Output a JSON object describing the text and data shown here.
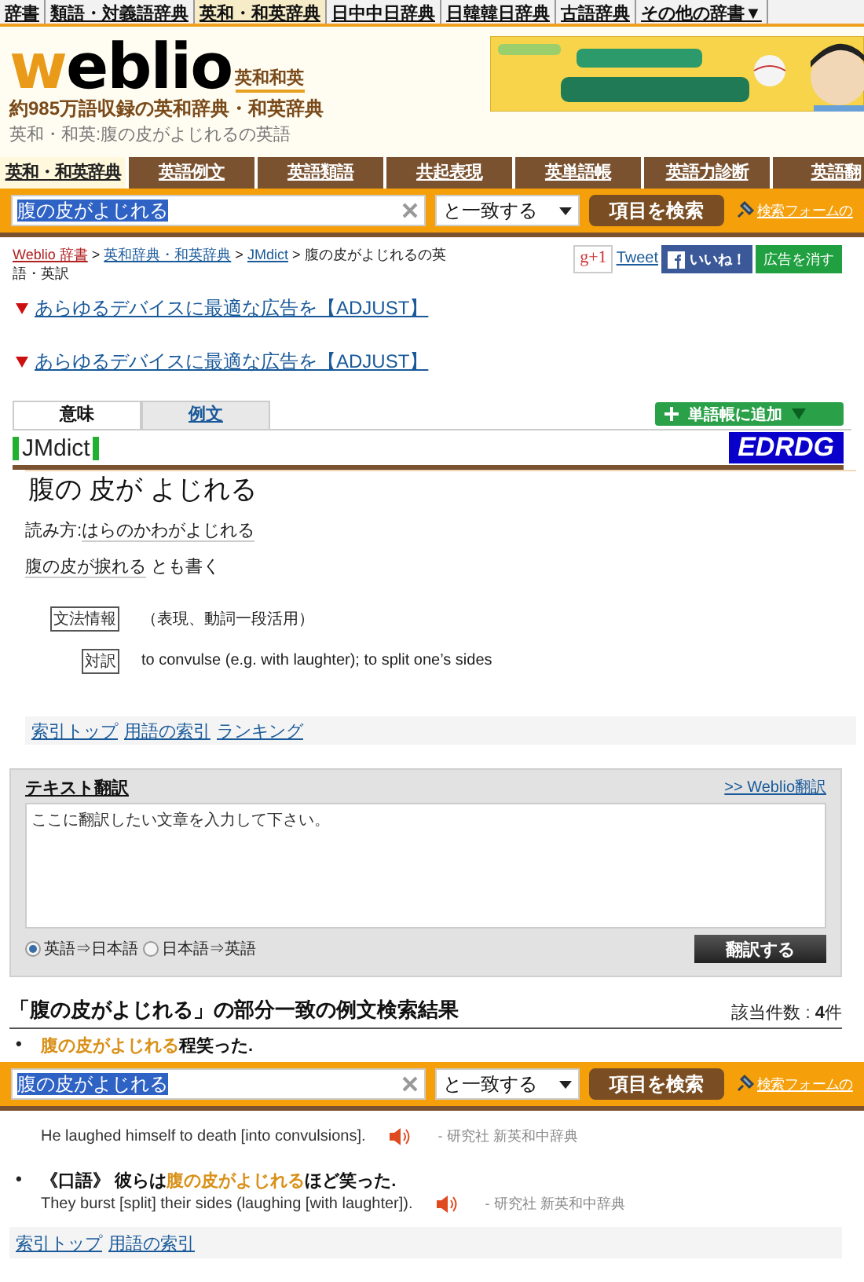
{
  "dict_nav": [
    {
      "label": "辞書",
      "selected": false
    },
    {
      "label": "類語・対義語辞典",
      "selected": false
    },
    {
      "label": "英和・和英辞典",
      "selected": true
    },
    {
      "label": "日中中日辞典",
      "selected": false
    },
    {
      "label": "日韓韓日辞典",
      "selected": false
    },
    {
      "label": "古語辞典",
      "selected": false
    },
    {
      "label": "その他の辞書▼",
      "selected": false
    }
  ],
  "header": {
    "logo_first": "w",
    "logo_rest": "eblio",
    "logo_sub": "英和和英",
    "tagline": "約985万語収録の英和辞典・和英辞典",
    "page_title": "英和・和英:腹の皮がよじれるの英語"
  },
  "section_tabs": [
    {
      "label": "英和・和英辞典",
      "selected": true
    },
    {
      "label": "英語例文",
      "selected": false
    },
    {
      "label": "英語類語",
      "selected": false
    },
    {
      "label": "共起表現",
      "selected": false
    },
    {
      "label": "英単語帳",
      "selected": false
    },
    {
      "label": "英語力診断",
      "selected": false
    },
    {
      "label": "英語翻",
      "selected": false
    }
  ],
  "search_bar": {
    "value": "腹の皮がよじれる",
    "match_mode": "と一致する",
    "button": "項目を検索",
    "form_link": "検索フォームの"
  },
  "breadcrumb": {
    "separator": ">",
    "items": [
      {
        "label": "Weblio 辞書",
        "kind": "home"
      },
      {
        "label": "英和辞典・和英辞典",
        "kind": "link"
      },
      {
        "label": "JMdict",
        "kind": "link"
      },
      {
        "label": "腹の皮がよじれるの英語・英訳",
        "kind": "current"
      }
    ]
  },
  "social": {
    "gplus": "g+1",
    "tweet": "Tweet",
    "like": "いいね！",
    "remove_ads": "広告を消す"
  },
  "ad_links": [
    "あらゆるデバイスに最適な広告を【ADJUST】",
    "あらゆるデバイスに最適な広告を【ADJUST】"
  ],
  "content_tabs": [
    {
      "label": "意味",
      "selected": true
    },
    {
      "label": "例文",
      "selected": false
    }
  ],
  "add_wordbook": "単語帳に追加",
  "source": {
    "name": "JMdict",
    "logo": "EDRDG"
  },
  "entry": {
    "headword": "腹の 皮が よじれる",
    "reading_label": "読み方:",
    "reading": "はらのかわがよじれる",
    "alt_form": "腹の皮が捩れる",
    "alt_suffix": "とも書く",
    "fields": [
      {
        "label": "文法情報",
        "value": "（表現、動詞一段活用）"
      },
      {
        "label": "対訳",
        "value": "to convulse (e.g. with laughter); to split one’s sides"
      }
    ]
  },
  "index_links": [
    "索引トップ",
    "用語の索引",
    "ランキング"
  ],
  "text_translation": {
    "title": "テキスト翻訳",
    "link": ">> Weblio翻訳",
    "placeholder": "ここに翻訳したい文章を入力して下さい。",
    "directions": [
      {
        "label": "英語⇒日本語",
        "selected": true
      },
      {
        "label": "日本語⇒英語",
        "selected": false
      }
    ],
    "button": "翻訳する"
  },
  "examples": {
    "title": "「腹の皮がよじれる」の部分一致の例文検索結果",
    "count": "該当件数 : **4**件",
    "bullet": "•",
    "items": [
      {
        "match": "腹の皮がよじれる",
        "after": "程笑った."
      },
      {
        "english": "He laughed himself to death [into convulsions].",
        "source": "- 研究社 新英和中辞典"
      },
      {
        "before": "《口語》 彼らは",
        "match": "腹の皮がよじれる",
        "after": "ほど笑った.",
        "english": "They burst [split] their sides (laughing [with laughter]).",
        "source": "- 研究社 新英和中辞典"
      }
    ]
  },
  "footer_links": [
    "索引トップ",
    "用語の索引"
  ],
  "sticky_search": {
    "value": "腹の皮がよじれる",
    "match_mode": "と一致する",
    "button": "項目を検索",
    "form_link": "検索フォームの"
  }
}
